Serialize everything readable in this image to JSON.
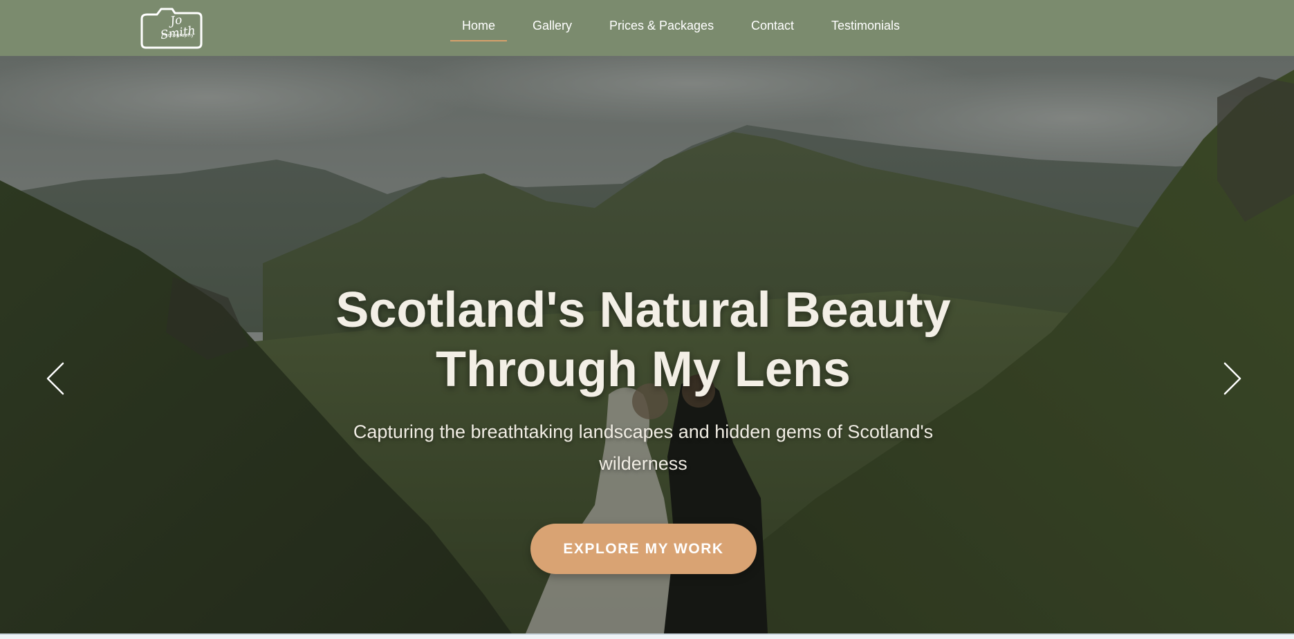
{
  "logo": {
    "script": "Jo Smith",
    "sub": "Photography"
  },
  "nav": {
    "items": [
      {
        "label": "Home",
        "active": true
      },
      {
        "label": "Gallery",
        "active": false
      },
      {
        "label": "Prices & Packages",
        "active": false
      },
      {
        "label": "Contact",
        "active": false
      },
      {
        "label": "Testimonials",
        "active": false
      }
    ]
  },
  "hero": {
    "title_line1": "Scotland's Natural Beauty",
    "title_line2": "Through My Lens",
    "subtitle": "Capturing the breathtaking landscapes and hidden gems of Scotland's wilderness",
    "cta_label": "EXPLORE MY WORK",
    "prev_icon": "chevron-left-icon",
    "next_icon": "chevron-right-icon"
  },
  "colors": {
    "nav_bg": "#7b8b6e",
    "accent": "#d9a373",
    "active_underline": "#d7a06b",
    "hero_text": "#f3efe6"
  }
}
